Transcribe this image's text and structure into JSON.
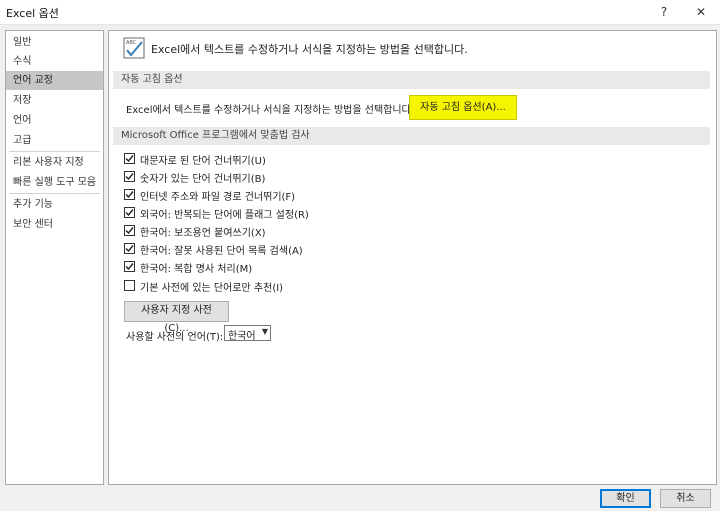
{
  "window": {
    "title": "Excel 옵션",
    "help": "?",
    "close": "✕"
  },
  "sidebar": {
    "items": [
      {
        "label": "일반"
      },
      {
        "label": "수식"
      },
      {
        "label": "언어 교정"
      },
      {
        "label": "저장"
      },
      {
        "label": "언어"
      },
      {
        "label": "고급"
      },
      {
        "label": "리본 사용자 지정"
      },
      {
        "label": "빠른 실행 도구 모음"
      },
      {
        "label": "추가 기능"
      },
      {
        "label": "보안 센터"
      }
    ]
  },
  "main": {
    "header": "Excel에서 텍스트를 수정하거나 서식을 지정하는 방법을 선택합니다.",
    "autocorrect": {
      "section_title": "자동 고침 옵션",
      "description": "Excel에서 텍스트를 수정하거나 서식을 지정하는 방법을 선택합니다.",
      "button": "자동 고침 옵션(A)..."
    },
    "spelling": {
      "section_title": "Microsoft Office 프로그램에서 맞춤법 검사",
      "options": [
        {
          "label": "대문자로 된 단어 건너뛰기(U)",
          "checked": true
        },
        {
          "label": "숫자가 있는 단어 건너뛰기(B)",
          "checked": true
        },
        {
          "label": "인터넷 주소와 파일 경로 건너뛰기(F)",
          "checked": true
        },
        {
          "label": "외국어: 반복되는 단어에 플래그 설정(R)",
          "checked": true
        },
        {
          "label": "한국어: 보조용언 붙여쓰기(X)",
          "checked": true
        },
        {
          "label": "한국어: 잘못 사용된 단어 목록 검색(A)",
          "checked": true
        },
        {
          "label": "한국어: 복합 명사 처리(M)",
          "checked": true
        },
        {
          "label": "기본 사전에 있는 단어로만 추천(I)",
          "checked": false
        }
      ],
      "custom_dict_button": "사용자 지정 사전(C)...",
      "dict_lang_label": "사용할 사전의 언어(T):",
      "dict_lang_value": "한국어"
    }
  },
  "footer": {
    "ok": "확인",
    "cancel": "취소"
  }
}
